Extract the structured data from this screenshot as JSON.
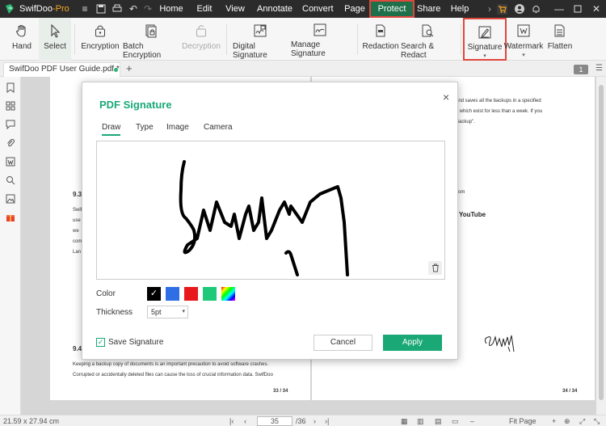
{
  "titlebar": {
    "app_name": "SwifDoo",
    "app_suffix": "-Pro",
    "menu": [
      "Home",
      "Edit",
      "View",
      "Annotate",
      "Convert",
      "Page",
      "Protect",
      "Share",
      "Help"
    ],
    "active_menu": "Protect"
  },
  "ribbon": {
    "hand": "Hand",
    "select": "Select",
    "encryption": "Encryption",
    "batch_encryption": "Batch Encryption",
    "decryption": "Decryption",
    "digital_signature": "Digital Signature",
    "manage_signature": "Manage Signature",
    "redaction": "Redaction",
    "search_redact": "Search & Redact",
    "signature": "Signature",
    "watermark": "Watermark",
    "flatten": "Flatten"
  },
  "tabs": {
    "doc_tab": "SwifDoo PDF User Guide.pdf *",
    "add": "+",
    "page_badge": "1"
  },
  "document": {
    "left_heading_1": "9.3",
    "left_lines": [
      "Swif",
      "use",
      "we",
      "com",
      "Lan"
    ],
    "left_heading_2": "9.4",
    "left_bottom": [
      "Keeping a backup copy of documents is an important precaution to avoid software crashes.",
      "Corrupted or accidentally deleted files can cause the loss of crucial information data. SwifDoo"
    ],
    "left_page_num": "33 / 34",
    "right_lines": [
      "and saves all the backups in a specified",
      "s which exist for less than a week. If you",
      "Backup\"."
    ],
    "right_link": "com",
    "right_youtube": "YouTube",
    "right_page_num": "34 / 34"
  },
  "dialog": {
    "title": "PDF Signature",
    "close": "×",
    "tabs": [
      "Draw",
      "Type",
      "Image",
      "Camera"
    ],
    "active_tab": "Draw",
    "color_label": "Color",
    "thickness_label": "Thickness",
    "thickness_value": "5pt",
    "colors": [
      "#000000",
      "#2e6fe6",
      "#e8191d",
      "#1ec97a"
    ],
    "save_signature": "Save Signature",
    "cancel": "Cancel",
    "apply": "Apply"
  },
  "statusbar": {
    "page_size": "21.59 x 27.94 cm",
    "current_page": "35",
    "total_pages": "/36",
    "zoom_mode": "Fit Page"
  }
}
